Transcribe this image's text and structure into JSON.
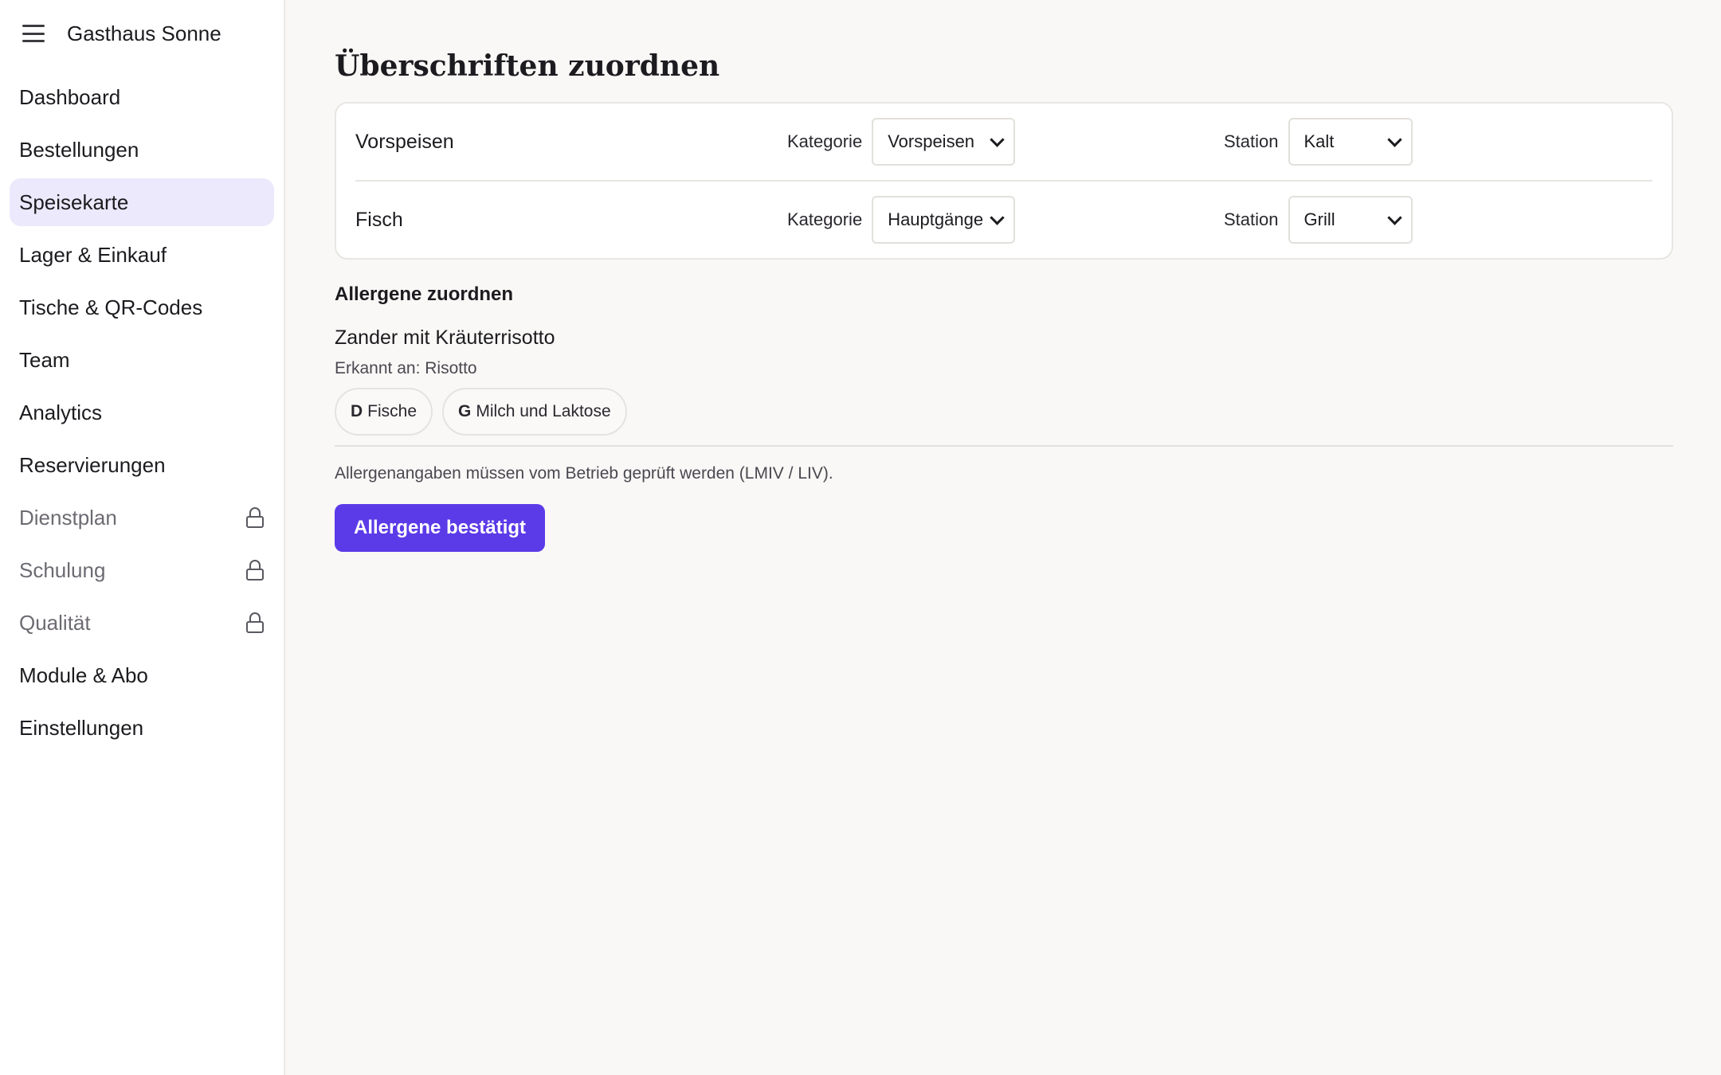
{
  "sidebar": {
    "app_title": "Gasthaus Sonne",
    "items": [
      {
        "label": "Dashboard"
      },
      {
        "label": "Bestellungen"
      },
      {
        "label": "Speisekarte",
        "active": true
      },
      {
        "label": "Lager & Einkauf"
      },
      {
        "label": "Tische & QR-Codes"
      },
      {
        "label": "Team"
      },
      {
        "label": "Analytics"
      },
      {
        "label": "Reservierungen"
      },
      {
        "label": "Dienstplan",
        "locked": true
      },
      {
        "label": "Schulung",
        "locked": true
      },
      {
        "label": "Qualität",
        "locked": true
      },
      {
        "label": "Module & Abo"
      },
      {
        "label": "Einstellungen"
      }
    ]
  },
  "main": {
    "title": "Überschriften zuordnen",
    "mapping": {
      "category_label": "Kategorie",
      "station_label": "Station",
      "rows": [
        {
          "heading": "Vorspeisen",
          "category": "Vorspeisen",
          "station": "Kalt"
        },
        {
          "heading": "Fisch",
          "category": "Hauptgänge",
          "station": "Grill"
        }
      ]
    },
    "allergens": {
      "section_title": "Allergene zuordnen",
      "dish": "Zander mit Kräuterrisotto",
      "detected": "Erkannt an: Risotto",
      "chips": [
        {
          "code": "D",
          "name": "Fische"
        },
        {
          "code": "G",
          "name": "Milch und Laktose"
        }
      ],
      "note": "Allergenangaben müssen vom Betrieb geprüft werden (LMIV / LIV).",
      "confirm_label": "Allergene bestätigt"
    }
  },
  "colors": {
    "accent": "#5b3be8",
    "active_nav_bg": "#ece9fc",
    "page_bg": "#f9f8f6"
  }
}
